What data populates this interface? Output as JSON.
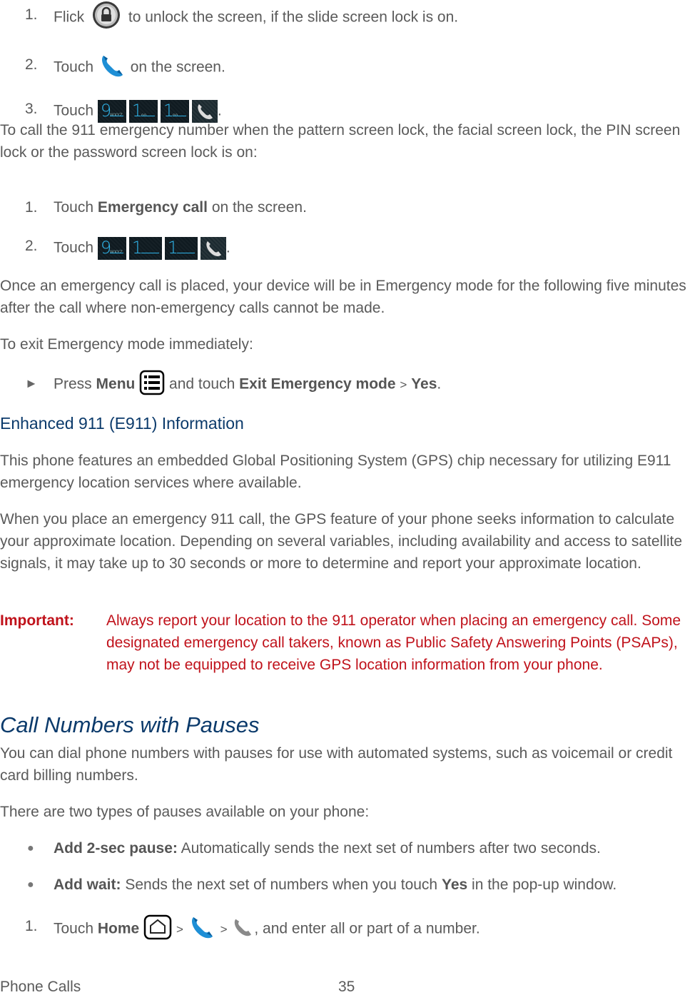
{
  "steps_a": [
    {
      "num": "1.",
      "pre": "Flick",
      "icon": "lock-icon",
      "post": "to unlock the screen, if the slide screen lock is on."
    },
    {
      "num": "2.",
      "pre": "Touch",
      "icon": "phone-icon",
      "post": "on the screen."
    },
    {
      "num": "3.",
      "pre": "Touch",
      "keys": [
        "9",
        "1",
        "1"
      ],
      "key_subs": [
        "WXYZ",
        "oo",
        "oo"
      ],
      "post": "."
    }
  ],
  "para_locked": "To call the 911 emergency number when the pattern screen lock, the facial screen lock, the PIN screen lock or the password screen lock is on:",
  "steps_b": [
    {
      "num": "1.",
      "pre": "Touch",
      "bold": "Emergency call",
      "post": "on the screen."
    },
    {
      "num": "2.",
      "pre": "Touch",
      "keys": [
        "9",
        "1",
        "1"
      ],
      "key_subs": [
        "WXYZ",
        "",
        ""
      ],
      "post": "."
    }
  ],
  "para_emergency_mode": "Once an emergency call is placed, your device will be in Emergency mode for the following five minutes after the call where non-emergency calls cannot be made.",
  "para_exit": "To exit Emergency mode immediately:",
  "exit_step": {
    "bullet": "►",
    "pre": "Press",
    "menu_label": "Menu",
    "mid": "and touch",
    "exit_label": "Exit Emergency mode",
    "sep": ">",
    "yes_label": "Yes",
    "end": "."
  },
  "e911_heading": "Enhanced 911 (E911) Information",
  "e911_para1": "This phone features an embedded Global Positioning System (GPS) chip necessary for utilizing E911 emergency location services where available.",
  "e911_para2": "When you place an emergency 911 call, the GPS feature of your phone seeks information to calculate your approximate location. Depending on several variables, including availability and access to satellite signals, it may take up to 30 seconds or more to determine and report your approximate location.",
  "important": {
    "label": "Important:",
    "text": "Always report your location to the 911 operator when placing an emergency call. Some designated emergency call takers, known as Public Safety Answering Points (PSAPs), may not be equipped to receive GPS location information from your phone."
  },
  "pauses_heading": "Call Numbers with Pauses",
  "pauses_para1": "You can dial phone numbers with pauses for use with automated systems, such as voicemail or credit card billing numbers.",
  "pauses_para2": "There are two types of pauses available on your phone:",
  "pause_types": [
    {
      "bullet": "●",
      "label": "Add 2-sec pause:",
      "text": "Automatically sends the next set of numbers after two seconds."
    },
    {
      "bullet": "●",
      "label": "Add wait:",
      "text": "Sends the next set of numbers when you touch",
      "bold2": "Yes",
      "text2": "in the pop-up window."
    }
  ],
  "final_step": {
    "num": "1.",
    "pre": "Touch",
    "home_label": "Home",
    "sep": ">",
    "post": ", and enter all or part of a number."
  },
  "footer": {
    "section": "Phone Calls",
    "page": "35"
  },
  "colors": {
    "heading_blue": "#0b3a6b",
    "important_red": "#c0121b",
    "body_gray": "#5a5a5a",
    "key_blue": "#2fb4e9"
  }
}
